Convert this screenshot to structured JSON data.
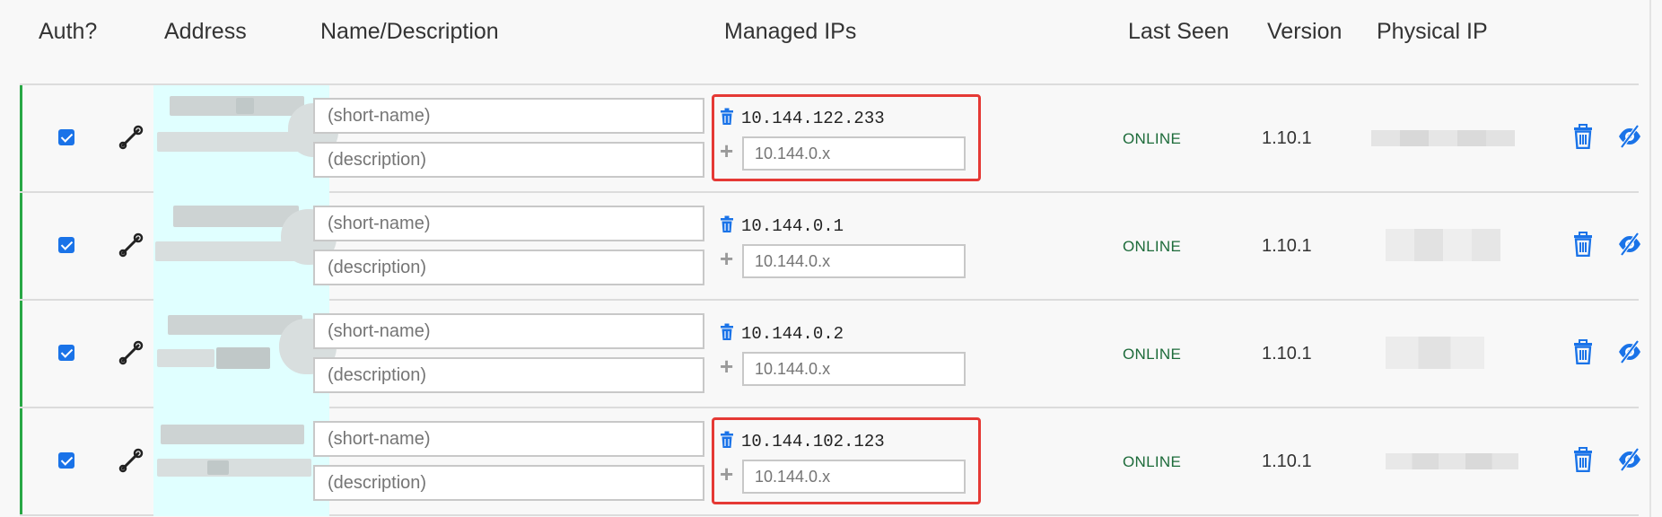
{
  "header": {
    "auth": "Auth?",
    "address": "Address",
    "name_description": "Name/Description",
    "managed_ips": "Managed IPs",
    "last_seen": "Last Seen",
    "version": "Version",
    "physical_ip": "Physical IP"
  },
  "rows": [
    {
      "authorized": true,
      "short_name_placeholder": "(short-name)",
      "description_placeholder": "(description)",
      "managed_ip": "10.144.122.233",
      "add_ip_placeholder": "10.144.0.x",
      "last_seen": "ONLINE",
      "version": "1.10.1",
      "highlighted": true
    },
    {
      "authorized": true,
      "short_name_placeholder": "(short-name)",
      "description_placeholder": "(description)",
      "managed_ip": "10.144.0.1",
      "add_ip_placeholder": "10.144.0.x",
      "last_seen": "ONLINE",
      "version": "1.10.1",
      "highlighted": false
    },
    {
      "authorized": true,
      "short_name_placeholder": "(short-name)",
      "description_placeholder": "(description)",
      "managed_ip": "10.144.0.2",
      "add_ip_placeholder": "10.144.0.x",
      "last_seen": "ONLINE",
      "version": "1.10.1",
      "highlighted": false
    },
    {
      "authorized": true,
      "short_name_placeholder": "(short-name)",
      "description_placeholder": "(description)",
      "managed_ip": "10.144.102.123",
      "add_ip_placeholder": "10.144.0.x",
      "last_seen": "ONLINE",
      "version": "1.10.1",
      "highlighted": true
    }
  ],
  "icons": {
    "auth": "checkbox-checked-icon",
    "address_action": "wrench-icon",
    "remove_ip": "trash-icon",
    "add_ip": "plus-icon",
    "delete_member": "trash-icon",
    "hide_member": "eye-slash-icon"
  },
  "colors": {
    "accent_blue": "#1a73e8",
    "online_green": "#1d6b3a",
    "authorized_bar": "#28a745",
    "highlight_box": "#e53935",
    "address_cell_bg": "#e0ffff"
  }
}
